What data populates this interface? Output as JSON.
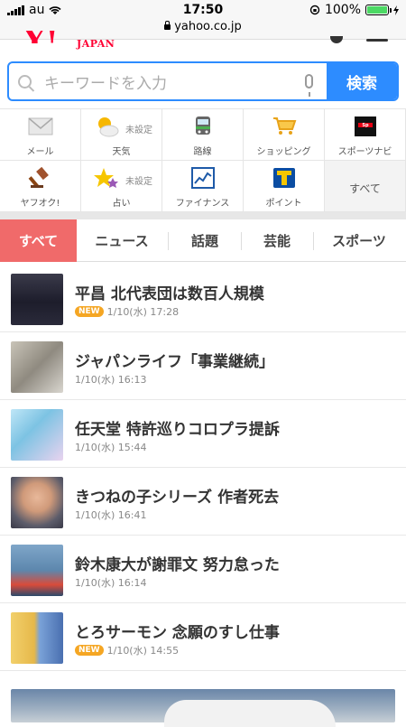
{
  "status": {
    "carrier": "au",
    "time": "17:50",
    "battery": "100%",
    "battery_level": 1.0
  },
  "url": "yahoo.co.jp",
  "logo_sub": "JAPAN",
  "search": {
    "placeholder": "キーワードを入力",
    "button": "検索"
  },
  "services": [
    {
      "label": "メール",
      "icon": "mail-icon"
    },
    {
      "label": "天気",
      "sub": "未設定",
      "icon": "weather-icon"
    },
    {
      "label": "路線",
      "icon": "train-icon"
    },
    {
      "label": "ショッピング",
      "icon": "cart-icon"
    },
    {
      "label": "スポーツナビ",
      "icon": "sportsnavi-icon"
    },
    {
      "label": "ヤフオク!",
      "icon": "auction-gavel-icon"
    },
    {
      "label": "占い",
      "sub": "未設定",
      "icon": "star-fortune-icon"
    },
    {
      "label": "ファイナンス",
      "icon": "finance-chart-icon"
    },
    {
      "label": "ポイント",
      "icon": "tpoint-icon"
    },
    {
      "label": "すべて"
    }
  ],
  "tabs": [
    "すべて",
    "ニュース",
    "話題",
    "芸能",
    "スポーツ"
  ],
  "news": [
    {
      "title": "平昌 北代表団は数百人規模",
      "new": "NEW",
      "time": "1/10(水) 17:28"
    },
    {
      "title": "ジャパンライフ「事業継続」",
      "time": "1/10(水) 16:13"
    },
    {
      "title": "任天堂 特許巡りコロプラ提訴",
      "time": "1/10(水) 15:44"
    },
    {
      "title": "きつねの子シリーズ 作者死去",
      "time": "1/10(水) 16:41"
    },
    {
      "title": "鈴木康大が謝罪文 努力怠った",
      "time": "1/10(水) 16:14"
    },
    {
      "title": "とろサーモン 念願のすし仕事",
      "new": "NEW",
      "time": "1/10(水) 14:55"
    }
  ],
  "colors": {
    "accent_blue": "#2d8cff",
    "active_tab": "#f06a6a",
    "new_badge": "#f5a623",
    "brand_red": "#ff0033"
  }
}
